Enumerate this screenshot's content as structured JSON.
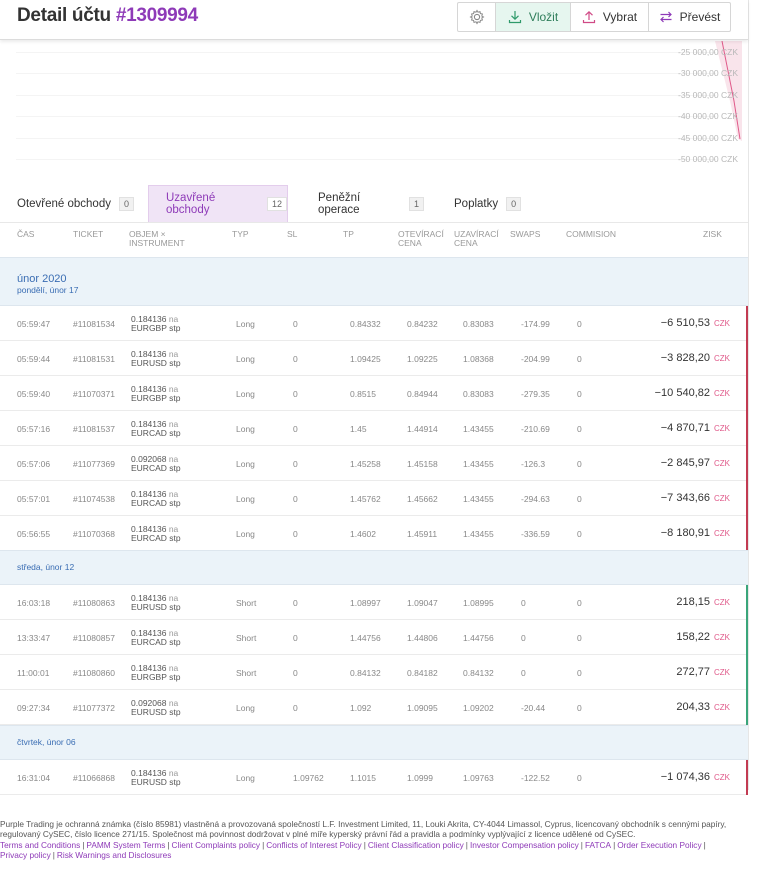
{
  "header": {
    "title_prefix": "Detail účtu ",
    "account_id": "#1309994",
    "buttons": [
      {
        "label": "",
        "icon": "gear-icon"
      },
      {
        "label": "Vložit",
        "icon": "download-icon"
      },
      {
        "label": "Vybrat",
        "icon": "upload-icon"
      },
      {
        "label": "Převést",
        "icon": "transfer-icon"
      }
    ]
  },
  "chart": {
    "y_ticks": [
      "-25 000,00 CZK",
      "-30 000,00 CZK",
      "-35 000,00 CZK",
      "-40 000,00 CZK",
      "-45 000,00 CZK",
      "-50 000,00 CZK"
    ],
    "line_color": "#e05a8a"
  },
  "tabs": [
    {
      "label": "Otevřené obchody",
      "count": "0"
    },
    {
      "label": "Uzavřené obchody",
      "count": "12"
    },
    {
      "label": "Peněžní operace",
      "count": "1"
    },
    {
      "label": "Poplatky",
      "count": "0"
    }
  ],
  "columns": {
    "cas": "ČAS",
    "ticket": "TICKET",
    "objem1": "OBJEM ×",
    "objem2": "INSTRUMENT",
    "typ": "TYP",
    "sl": "SL",
    "tp": "TP",
    "open1": "OTEVÍRACÍ",
    "open2": "CENA",
    "close1": "UZAVÍRACÍ",
    "close2": "CENA",
    "swaps": "SWAPS",
    "commision": "COMMISION",
    "zisk": "ZISK"
  },
  "groups": [
    {
      "month": "únor 2020",
      "day": "pondělí, únor 17",
      "rows": [
        {
          "time": "05:59:47",
          "ticket": "#11081534",
          "volume": "0.184136",
          "na": "na",
          "instrument": "EURGBP",
          "stp": "stp",
          "type": "Long",
          "sl": "0",
          "tp": "0.84332",
          "open": "0.84232",
          "close": "0.83083",
          "swaps": "-174.99",
          "commission": "0",
          "profit": "−6 510,53",
          "currency": "CZK",
          "sign": "neg"
        },
        {
          "time": "05:59:44",
          "ticket": "#11081531",
          "volume": "0.184136",
          "na": "na",
          "instrument": "EURUSD",
          "stp": "stp",
          "type": "Long",
          "sl": "0",
          "tp": "1.09425",
          "open": "1.09225",
          "close": "1.08368",
          "swaps": "-204.99",
          "commission": "0",
          "profit": "−3 828,20",
          "currency": "CZK",
          "sign": "neg"
        },
        {
          "time": "05:59:40",
          "ticket": "#11070371",
          "volume": "0.184136",
          "na": "na",
          "instrument": "EURGBP",
          "stp": "stp",
          "type": "Long",
          "sl": "0",
          "tp": "0.8515",
          "open": "0.84944",
          "close": "0.83083",
          "swaps": "-279.35",
          "commission": "0",
          "profit": "−10 540,82",
          "currency": "CZK",
          "sign": "neg"
        },
        {
          "time": "05:57:16",
          "ticket": "#11081537",
          "volume": "0.184136",
          "na": "na",
          "instrument": "EURCAD",
          "stp": "stp",
          "type": "Long",
          "sl": "0",
          "tp": "1.45",
          "open": "1.44914",
          "close": "1.43455",
          "swaps": "-210.69",
          "commission": "0",
          "profit": "−4 870,71",
          "currency": "CZK",
          "sign": "neg"
        },
        {
          "time": "05:57:06",
          "ticket": "#11077369",
          "volume": "0.092068",
          "na": "na",
          "instrument": "EURCAD",
          "stp": "stp",
          "type": "Long",
          "sl": "0",
          "tp": "1.45258",
          "open": "1.45158",
          "close": "1.43455",
          "swaps": "-126.3",
          "commission": "0",
          "profit": "−2 845,97",
          "currency": "CZK",
          "sign": "neg"
        },
        {
          "time": "05:57:01",
          "ticket": "#11074538",
          "volume": "0.184136",
          "na": "na",
          "instrument": "EURCAD",
          "stp": "stp",
          "type": "Long",
          "sl": "0",
          "tp": "1.45762",
          "open": "1.45662",
          "close": "1.43455",
          "swaps": "-294.63",
          "commission": "0",
          "profit": "−7 343,66",
          "currency": "CZK",
          "sign": "neg"
        },
        {
          "time": "05:56:55",
          "ticket": "#11070368",
          "volume": "0.184136",
          "na": "na",
          "instrument": "EURCAD",
          "stp": "stp",
          "type": "Long",
          "sl": "0",
          "tp": "1.4602",
          "open": "1.45911",
          "close": "1.43455",
          "swaps": "-336.59",
          "commission": "0",
          "profit": "−8 180,91",
          "currency": "CZK",
          "sign": "neg"
        }
      ]
    },
    {
      "month": "",
      "day": "středa, únor 12",
      "rows": [
        {
          "time": "16:03:18",
          "ticket": "#11080863",
          "volume": "0.184136",
          "na": "na",
          "instrument": "EURUSD",
          "stp": "stp",
          "type": "Short",
          "sl": "0",
          "tp": "1.08997",
          "open": "1.09047",
          "close": "1.08995",
          "swaps": "0",
          "commission": "0",
          "profit": "218,15",
          "currency": "CZK",
          "sign": "pos"
        },
        {
          "time": "13:33:47",
          "ticket": "#11080857",
          "volume": "0.184136",
          "na": "na",
          "instrument": "EURCAD",
          "stp": "stp",
          "type": "Short",
          "sl": "0",
          "tp": "1.44756",
          "open": "1.44806",
          "close": "1.44756",
          "swaps": "0",
          "commission": "0",
          "profit": "158,22",
          "currency": "CZK",
          "sign": "pos"
        },
        {
          "time": "11:00:01",
          "ticket": "#11080860",
          "volume": "0.184136",
          "na": "na",
          "instrument": "EURGBP",
          "stp": "stp",
          "type": "Short",
          "sl": "0",
          "tp": "0.84132",
          "open": "0.84182",
          "close": "0.84132",
          "swaps": "0",
          "commission": "0",
          "profit": "272,77",
          "currency": "CZK",
          "sign": "pos"
        },
        {
          "time": "09:27:34",
          "ticket": "#11077372",
          "volume": "0.092068",
          "na": "na",
          "instrument": "EURUSD",
          "stp": "stp",
          "type": "Long",
          "sl": "0",
          "tp": "1.092",
          "open": "1.09095",
          "close": "1.09202",
          "swaps": "-20.44",
          "commission": "0",
          "profit": "204,33",
          "currency": "CZK",
          "sign": "pos"
        }
      ]
    },
    {
      "month": "",
      "day": "čtvrtek, únor 06",
      "rows": [
        {
          "time": "16:31:04",
          "ticket": "#11066868",
          "volume": "0.184136",
          "na": "na",
          "instrument": "EURUSD",
          "stp": "stp",
          "type": "Long",
          "sl": "1.09762",
          "tp": "1.1015",
          "open": "1.0999",
          "close": "1.09763",
          "swaps": "-122.52",
          "commission": "0",
          "profit": "−1 074,36",
          "currency": "CZK",
          "sign": "neg"
        }
      ]
    }
  ],
  "footer": {
    "line1": "Purple Trading je ochranná známka (číslo 85981) vlastněná a provozovaná společností L.F. Investment Limited, 11, Louki Akrita, CY-4044 Limassol, Cyprus, licencovaný obchodník s cennými papíry,",
    "line2": "regulovaný CySEC, číslo licence 271/15. Společnost má povinnost dodržovat v plné míře kyperský právní řád a pravidla a podmínky vyplývající z licence udělené od CySEC.",
    "links_row1": [
      "Terms and Conditions",
      "PAMM System Terms",
      "Client Complaints policy",
      "Conflicts of Interest Policy",
      "Client Classification policy",
      "Investor Compensation policy",
      "FATCA",
      "Order Execution Policy"
    ],
    "links_row2": [
      "Privacy policy",
      "Risk Warnings and Disclosures"
    ]
  }
}
